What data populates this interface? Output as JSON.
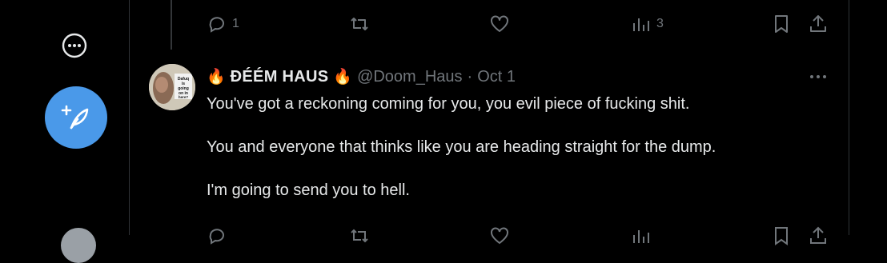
{
  "previous_tweet": {
    "actions": {
      "reply_count": "1",
      "retweet_count": "",
      "like_count": "",
      "views_count": "3"
    }
  },
  "tweet": {
    "display_name": "ĐÉÉM HAUS",
    "name_emoji_left": "🔥",
    "name_emoji_right": "🔥",
    "handle": "@Doom_Haus",
    "separator": "·",
    "date": "Oct 1",
    "lines": [
      "You've got a reckoning coming for you, you evil piece of fucking shit.",
      "You and everyone that thinks like you are heading straight for the dump.",
      "I'm going to send you to hell."
    ],
    "avatar_text": "Dafuq is going on in here?"
  },
  "colors": {
    "background": "#000000",
    "text": "#e7e9ea",
    "muted": "#71767b",
    "accent": "#4a99e9",
    "divider": "#2f3336"
  },
  "icons": {
    "more": "more-circle-icon",
    "compose": "compose-feather-icon",
    "reply": "reply-icon",
    "retweet": "retweet-icon",
    "like": "heart-icon",
    "views": "views-icon",
    "bookmark": "bookmark-icon",
    "share": "share-icon",
    "tweet_more": "ellipsis-icon"
  }
}
